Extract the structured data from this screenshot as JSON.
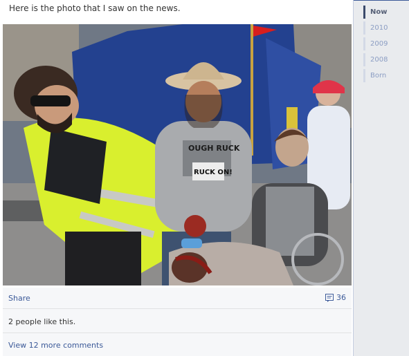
{
  "post": {
    "caption": "Here is the photo that I saw on the news.",
    "photo_icon": "news-photo",
    "share_label": "Share",
    "comment_count": "36",
    "likes_text": "2 people like this.",
    "more_comments_label": "View 12 more comments",
    "shirt_text_1": "OUGH RUCK",
    "shirt_text_2": "RUCK ON!"
  },
  "timeline": {
    "items": [
      "Now",
      "2010",
      "2009",
      "2008",
      "Born"
    ],
    "active_index": 0
  },
  "colors": {
    "link": "#3b5998",
    "timeline_active": "#3b4a6b"
  }
}
